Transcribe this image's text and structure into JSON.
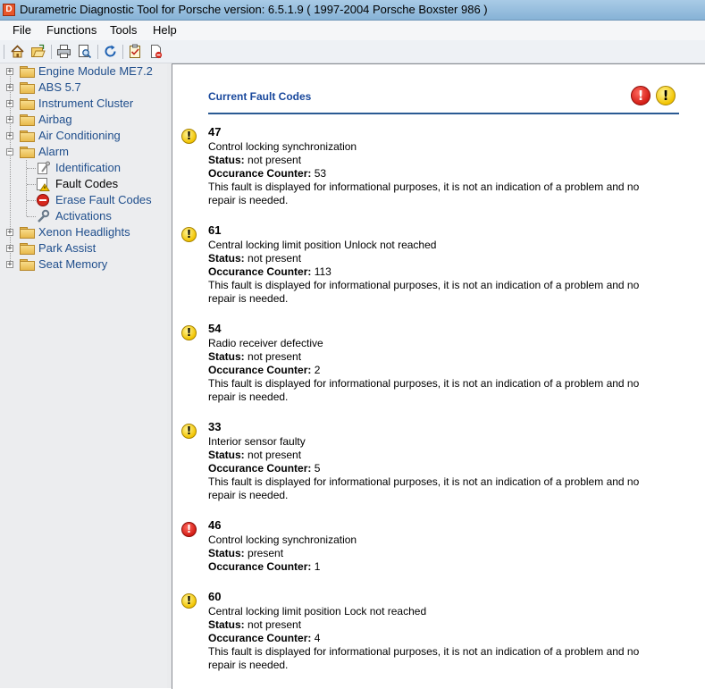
{
  "window": {
    "title": "Durametric Diagnostic Tool for Porsche version: 6.5.1.9  ( 1997-2004 Porsche Boxster 986 )"
  },
  "menu": [
    "File",
    "Functions",
    "Tools",
    "Help"
  ],
  "toolbar": [
    "home-icon",
    "open-folder-icon",
    "print-icon",
    "print-preview-icon",
    "refresh-icon",
    "checklist-icon",
    "document-delete-icon"
  ],
  "tree": {
    "items": [
      {
        "label": "Engine Module ME7.2",
        "expanded": false
      },
      {
        "label": "ABS 5.7",
        "expanded": false
      },
      {
        "label": "Instrument Cluster",
        "expanded": false
      },
      {
        "label": "Airbag",
        "expanded": false
      },
      {
        "label": "Air Conditioning",
        "expanded": false
      },
      {
        "label": "Alarm",
        "expanded": true,
        "children": [
          {
            "label": "Identification",
            "icon": "identification-icon"
          },
          {
            "label": "Fault Codes",
            "icon": "fault-codes-icon",
            "selected": true
          },
          {
            "label": "Erase Fault Codes",
            "icon": "erase-icon"
          },
          {
            "label": "Activations",
            "icon": "wrench-icon"
          }
        ]
      },
      {
        "label": "Xenon Headlights",
        "expanded": false
      },
      {
        "label": "Park Assist",
        "expanded": false
      },
      {
        "label": "Seat Memory",
        "expanded": false
      }
    ]
  },
  "panel": {
    "title": "Current Fault Codes",
    "status_label": "Status:",
    "counter_label": "Occurance Counter:",
    "faults": [
      {
        "code": "47",
        "severity": "warning",
        "description": "Control locking synchronization",
        "status": "not present",
        "counter": "53",
        "info_line1": "This fault is displayed for informational purposes, it is not an indication of a problem and no",
        "info_line2": "repair is needed."
      },
      {
        "code": "61",
        "severity": "warning",
        "description": "Central locking limit position Unlock not reached",
        "status": "not present",
        "counter": "113",
        "info_line1": "This fault is displayed for informational purposes, it is not an indication of a problem and no",
        "info_line2": "repair is needed."
      },
      {
        "code": "54",
        "severity": "warning",
        "description": "Radio receiver defective",
        "status": "not present",
        "counter": "2",
        "info_line1": "This fault is displayed for informational purposes, it is not an indication of a problem and no",
        "info_line2": "repair is needed."
      },
      {
        "code": "33",
        "severity": "warning",
        "description": "Interior sensor faulty",
        "status": "not present",
        "counter": "5",
        "info_line1": "This fault is displayed for informational purposes, it is not an indication of a problem and no",
        "info_line2": "repair is needed."
      },
      {
        "code": "46",
        "severity": "error",
        "description": "Control locking synchronization",
        "status": "present",
        "counter": "1"
      },
      {
        "code": "60",
        "severity": "warning",
        "description": "Central locking limit position Lock not reached",
        "status": "not present",
        "counter": "4",
        "info_line1": "This fault is displayed for informational purposes, it is not an indication of a problem and no",
        "info_line2": "repair is needed."
      }
    ]
  },
  "colors": {
    "link": "#1f4e8c",
    "title": "#19489c",
    "rule": "#2a5a93",
    "error": "#d31d16",
    "warning": "#f2c400"
  }
}
